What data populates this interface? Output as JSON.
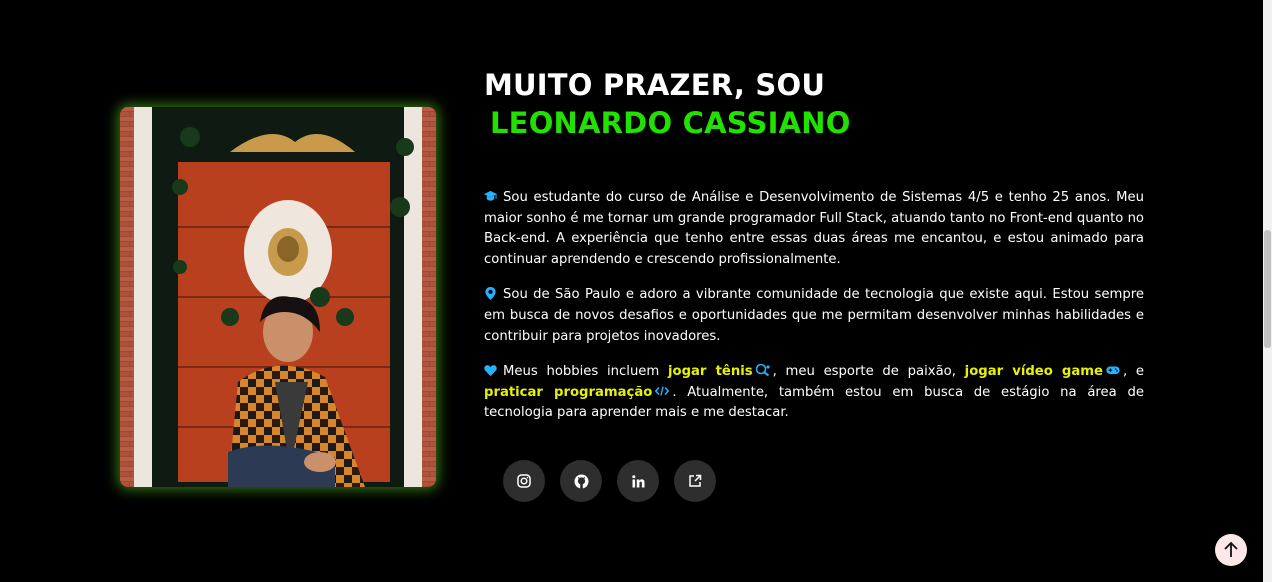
{
  "hero": {
    "title_line1": "MUITO PRAZER, SOU",
    "title_name": "LEONARDO CASSIANO",
    "accent_color": "#22e000",
    "highlight_color": "#e8f200"
  },
  "bio": {
    "p1": {
      "icon": "graduation-cap-icon",
      "text": "Sou estudante do curso de Análise e Desenvolvimento de Sistemas 4/5 e tenho 25 anos. Meu maior sonho é me tornar um grande programador Full Stack, atuando tanto no Front-end quanto no Back-end. A experiência que tenho entre essas duas áreas me encantou, e estou animado para continuar aprendendo e crescendo profissionalmente."
    },
    "p2": {
      "icon": "map-pin-icon",
      "text": "Sou de São Paulo e adoro a vibrante comunidade de tecnologia que existe aqui. Estou sempre em busca de novos desafios e oportunidades que me permitam desenvolver minhas habilidades e contribuir para projetos inovadores."
    },
    "p3": {
      "icon": "heart-icon",
      "intro": "Meus hobbies incluem",
      "hobby1": "jogar tênis",
      "sep1": ", meu esporte de paixão,",
      "hobby2": "jogar vídeo game",
      "sep2": ", e",
      "hobby3": "praticar programação",
      "outro": ". Atualmente, também estou em busca de estágio na área de tecnologia para aprender mais e me destacar."
    }
  },
  "social": [
    "instagram-icon",
    "github-icon",
    "linkedin-icon",
    "external-link-icon"
  ],
  "scroll_top_icon": "arrow-up-icon"
}
